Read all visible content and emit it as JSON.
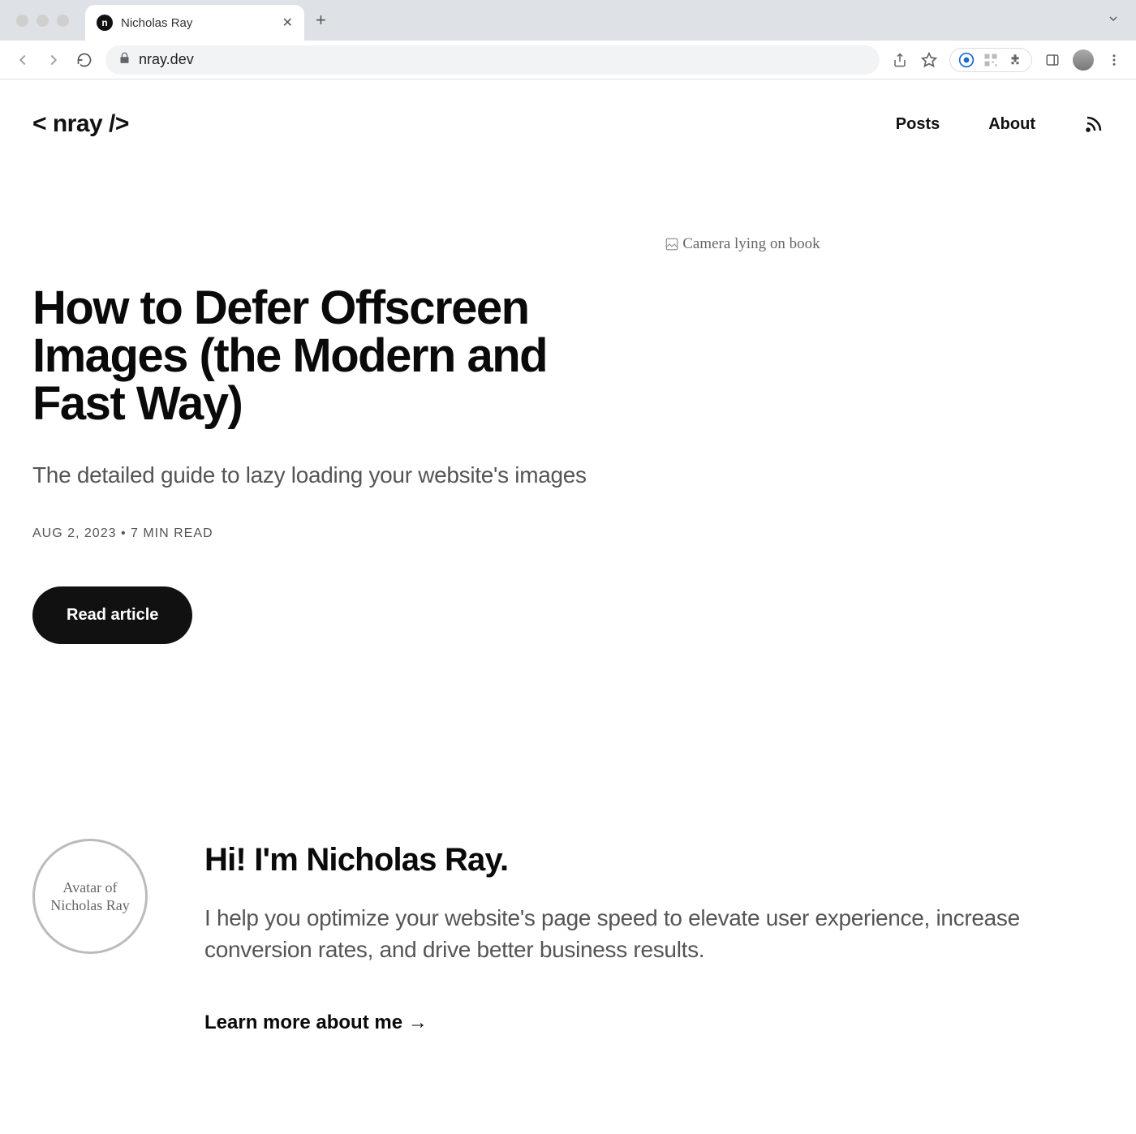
{
  "browser": {
    "tab_title": "Nicholas Ray",
    "url": "nray.dev"
  },
  "header": {
    "logo": "< nray />",
    "nav": {
      "posts": "Posts",
      "about": "About"
    }
  },
  "hero": {
    "title": "How to Defer Offscreen Images (the Modern and Fast Way)",
    "subtitle": "The detailed guide to lazy loading your website's images",
    "meta": "AUG 2, 2023 • 7 MIN READ",
    "cta": "Read article",
    "image_alt": "Camera lying on book"
  },
  "about": {
    "avatar_alt": "Avatar of Nicholas Ray",
    "heading": "Hi! I'm Nicholas Ray.",
    "text": "I help you optimize your website's page speed to elevate user experience, increase conversion rates, and drive better business results.",
    "link": "Learn more about me →"
  }
}
